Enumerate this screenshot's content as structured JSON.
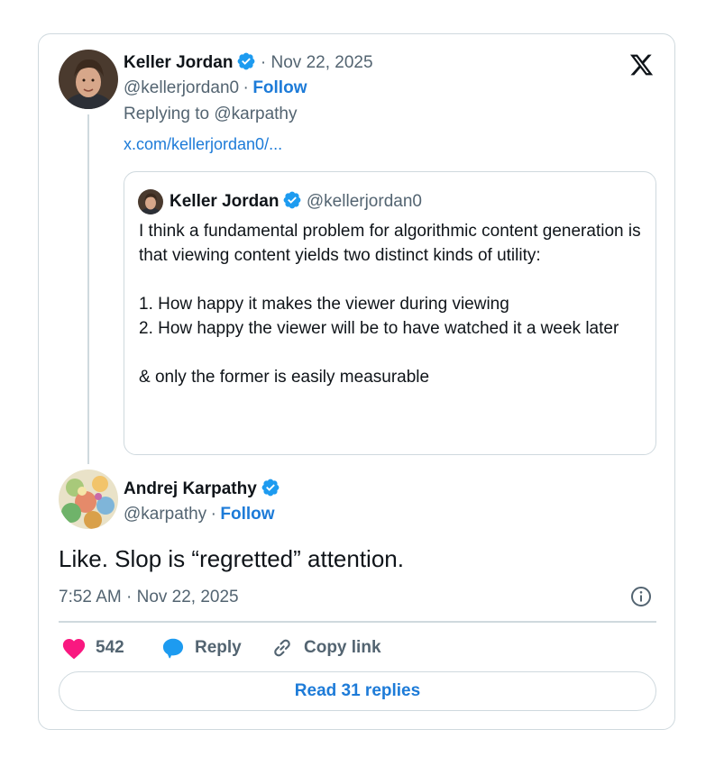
{
  "parent_tweet": {
    "author_name": "Keller Jordan",
    "date_sep": "· Nov 22, 2025",
    "handle": "@kellerjordan0",
    "handle_sep": "·",
    "follow_label": "Follow",
    "replying_to": "Replying to @karpathy",
    "link_text": "x.com/kellerjordan0/..."
  },
  "quoted_tweet": {
    "author_name": "Keller Jordan",
    "handle": "@kellerjordan0",
    "paragraph_1": "I think a fundamental problem for algorithmic content generation is that viewing content yields two distinct kinds of utility:",
    "item_1": "1. How happy it makes the viewer during viewing",
    "item_2": "2. How happy the viewer will be to have watched it a week later",
    "conclusion": "& only the former is easily measurable"
  },
  "main_tweet": {
    "author_name": "Andrej Karpathy",
    "handle": "@karpathy",
    "handle_sep": "·",
    "follow_label": "Follow",
    "text": "Like. Slop is “regretted” attention.",
    "timestamp": "7:52 AM · Nov 22, 2025"
  },
  "actions": {
    "like_count": "542",
    "reply_label": "Reply",
    "copy_link_label": "Copy link",
    "read_replies_label": "Read 31 replies"
  },
  "icons": {
    "platform": "x-logo-icon",
    "verified": "verified-badge-icon",
    "info": "info-icon",
    "like": "heart-icon",
    "reply": "speech-bubble-icon",
    "copy_link": "link-icon"
  },
  "colors": {
    "accent": "#1d7bd8",
    "like": "#f91880",
    "muted": "#536471",
    "border": "#cfd9de"
  }
}
